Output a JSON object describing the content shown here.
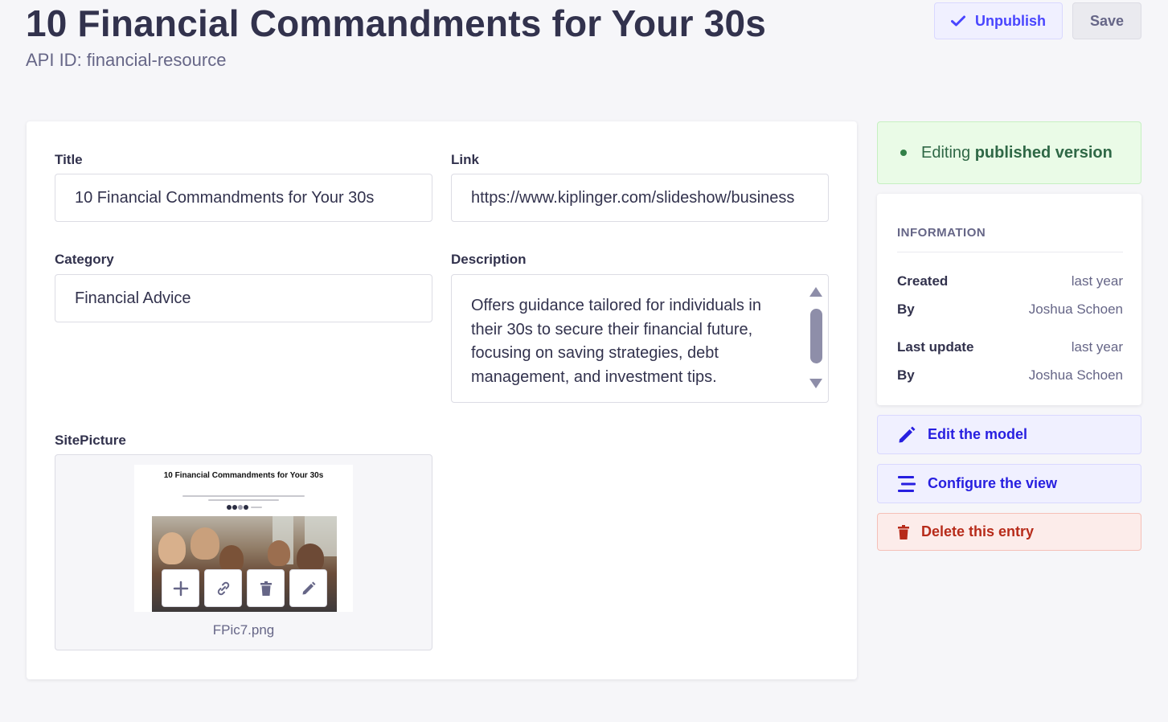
{
  "header": {
    "title": "10 Financial Commandments for Your 30s",
    "api_id": "API ID: financial-resource",
    "unpublish_label": "Unpublish",
    "save_label": "Save"
  },
  "form": {
    "title": {
      "label": "Title",
      "value": "10 Financial Commandments for Your 30s"
    },
    "link": {
      "label": "Link",
      "value": "https://www.kiplinger.com/slideshow/business"
    },
    "category": {
      "label": "Category",
      "value": "Financial Advice"
    },
    "description": {
      "label": "Description",
      "value": "Offers guidance tailored for individuals in their 30s to secure their financial future, focusing on saving strategies, debt management, and investment tips."
    },
    "site_picture": {
      "label": "SitePicture",
      "filename": "FPic7.png",
      "preview_title": "10 Financial Commandments for Your 30s",
      "actions": [
        "add-icon",
        "link-icon",
        "trash-icon",
        "pencil-icon"
      ]
    }
  },
  "sidebar": {
    "status": {
      "prefix": "Editing",
      "emphasis": "published version",
      "color": "#328048"
    },
    "information": {
      "heading": "INFORMATION",
      "created": {
        "label": "Created",
        "value": "last year"
      },
      "created_by": {
        "label": "By",
        "value": "Joshua Schoen"
      },
      "last_update": {
        "label": "Last update",
        "value": "last year"
      },
      "updated_by": {
        "label": "By",
        "value": "Joshua Schoen"
      }
    },
    "edit_model_label": "Edit the model",
    "configure_view_label": "Configure the view",
    "delete_entry_label": "Delete this entry"
  },
  "colors": {
    "primary": "#4945ff",
    "danger": "#b72b1a",
    "success": "#328048"
  }
}
